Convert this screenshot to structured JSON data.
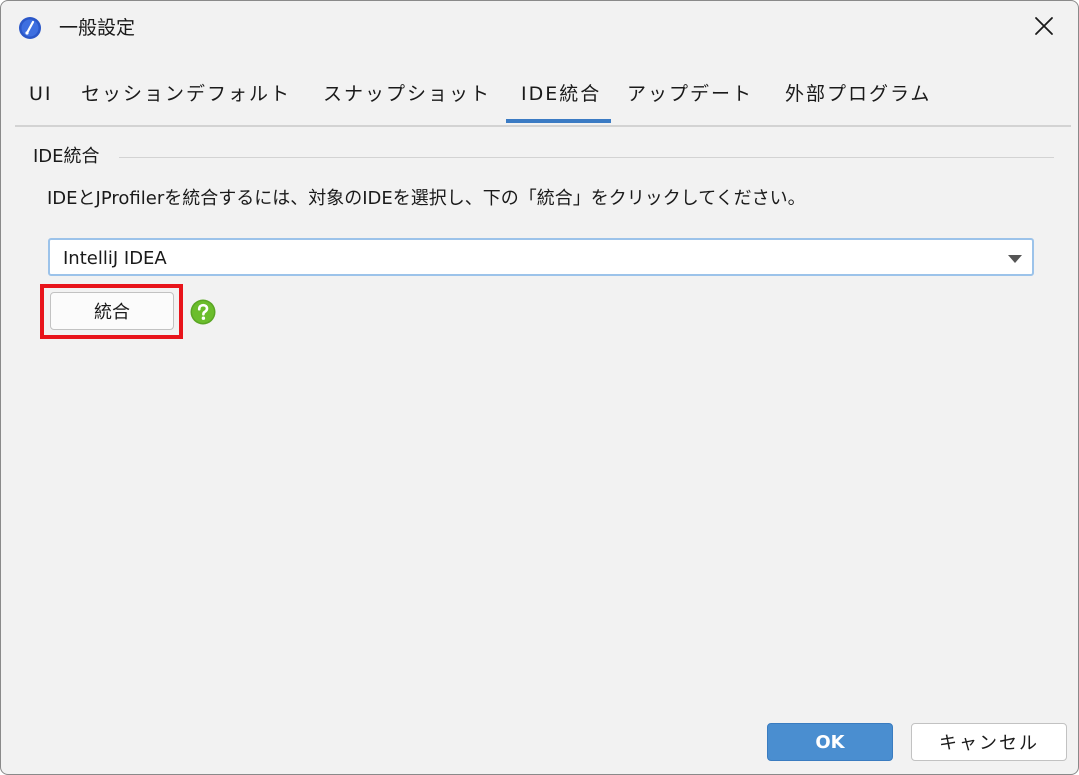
{
  "window": {
    "title": "一般設定",
    "app_icon": "jprofiler-gauge-icon",
    "close_icon": "close-icon"
  },
  "tabs": [
    {
      "label": "UI",
      "active": false
    },
    {
      "label": "セッションデフォルト",
      "active": false
    },
    {
      "label": "スナップショット",
      "active": false
    },
    {
      "label": "IDE統合",
      "active": true
    },
    {
      "label": "アップデート",
      "active": false
    },
    {
      "label": "外部プログラム",
      "active": false
    }
  ],
  "section": {
    "title": "IDE統合",
    "instruction": "IDEとJProfilerを統合するには、対象のIDEを選択し、下の「統合」をクリックしてください。",
    "ide_select": {
      "selected": "IntelliJ IDEA"
    },
    "integrate_button": "統合",
    "help_icon": "help-icon"
  },
  "footer": {
    "ok_label": "OK",
    "cancel_label": "キャンセル"
  },
  "colors": {
    "accent": "#3b7bc4",
    "ok_button": "#4a8ed0",
    "highlight": "#e8141b",
    "help_icon": "#5aa624",
    "background": "#f2f2f2"
  }
}
